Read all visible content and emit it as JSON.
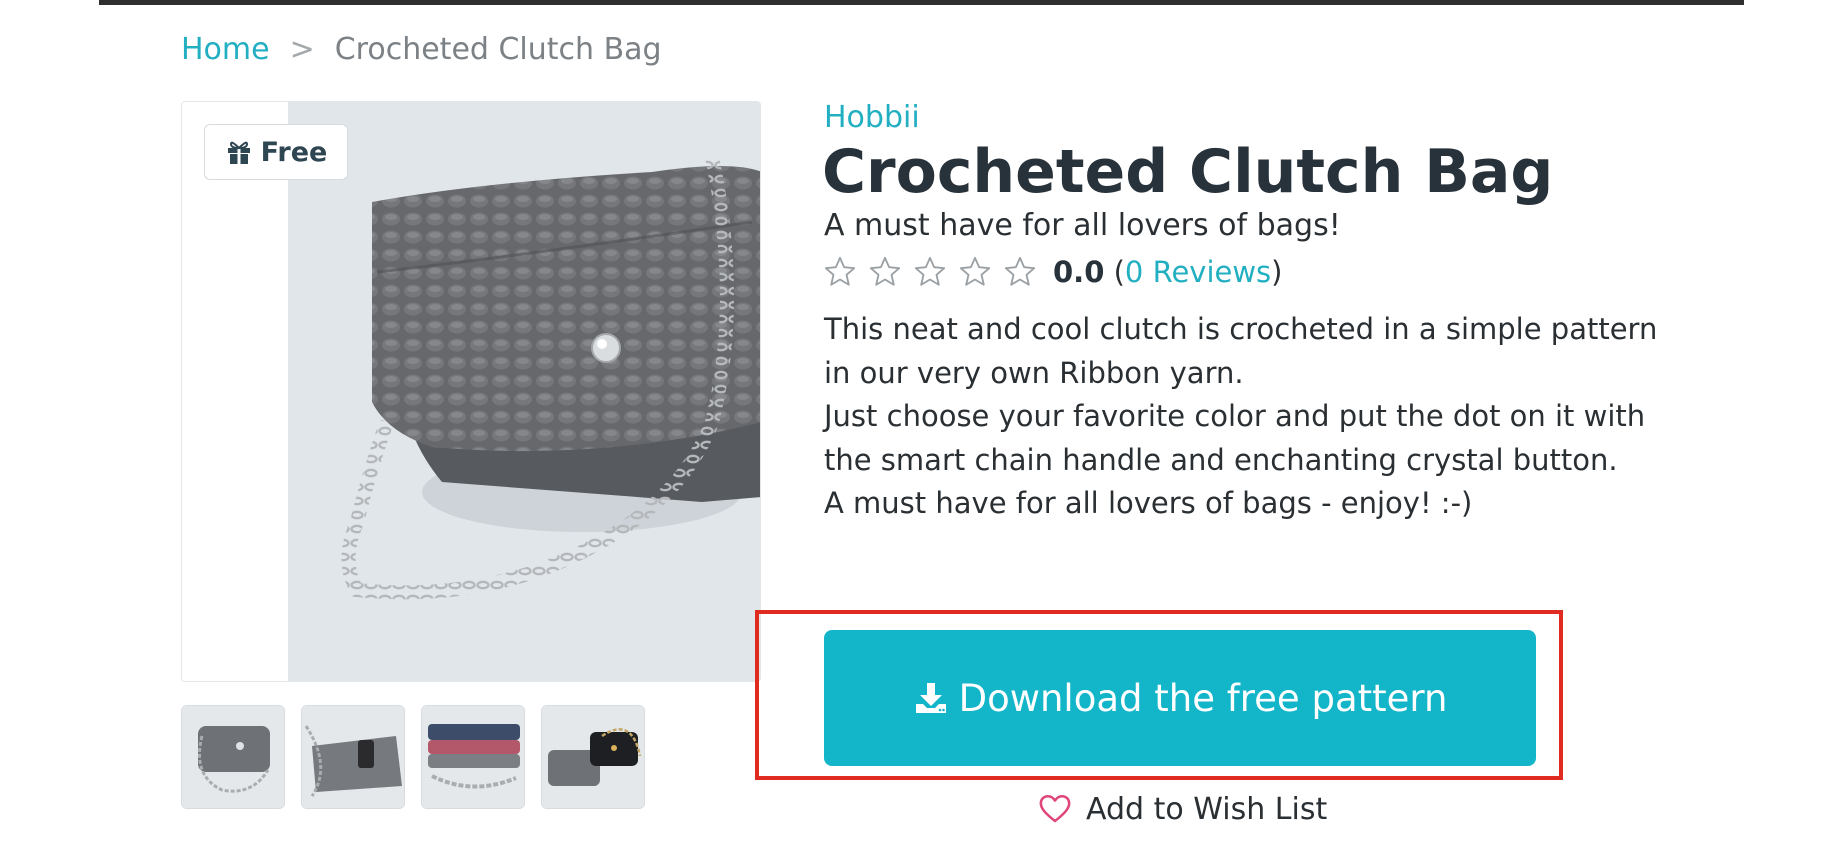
{
  "breadcrumb": {
    "home": "Home",
    "separator": ">",
    "current": "Crocheted Clutch Bag"
  },
  "badge": {
    "label": "Free",
    "icon": "gift-icon"
  },
  "product": {
    "brand": "Hobbii",
    "title": "Crocheted Clutch Bag",
    "subtitle": "A must have for all lovers of bags!",
    "rating": {
      "stars_filled": 0,
      "stars_total": 5,
      "value": "0.0",
      "open_paren": "(",
      "reviews_label": "0 Reviews",
      "close_paren": ")"
    },
    "description": [
      "This neat and cool clutch is crocheted in a simple pattern",
      "in our very own Ribbon yarn.",
      "Just choose your favorite color and put the dot on it with",
      "the smart chain handle and enchanting crystal button.",
      "A must have for all lovers of bags - enjoy! :-)"
    ]
  },
  "actions": {
    "download_label": "Download the free pattern",
    "download_icon": "download-icon",
    "wishlist_label": "Add to Wish List",
    "wishlist_icon": "heart-icon"
  },
  "colors": {
    "accent": "#22afc1",
    "button": "#13b5c9",
    "highlight_border": "#e02b20",
    "heart": "#e0467a",
    "title": "#28323a"
  },
  "thumbnails": [
    {
      "name": "grey-bag"
    },
    {
      "name": "open-bag-with-phone"
    },
    {
      "name": "stacked-bags"
    },
    {
      "name": "grey-and-black-bags"
    }
  ]
}
